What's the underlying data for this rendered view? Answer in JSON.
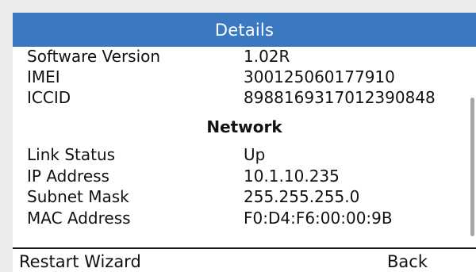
{
  "screen": {
    "title": "Details",
    "accent_color": "#3a78c2"
  },
  "info_rows": [
    {
      "label": "Software Version",
      "value": "1.02R"
    },
    {
      "label": "IMEI",
      "value": "300125060177910"
    },
    {
      "label": "ICCID",
      "value": "8988169317012390848"
    }
  ],
  "network": {
    "heading": "Network",
    "rows": [
      {
        "label": "Link Status",
        "value": "Up"
      },
      {
        "label": "IP Address",
        "value": "10.1.10.235"
      },
      {
        "label": "Subnet Mask",
        "value": "255.255.255.0"
      },
      {
        "label": "MAC Address",
        "value": "F0:D4:F6:00:00:9B"
      }
    ]
  },
  "softkeys": {
    "left": "Restart Wizard",
    "right": "Back"
  }
}
